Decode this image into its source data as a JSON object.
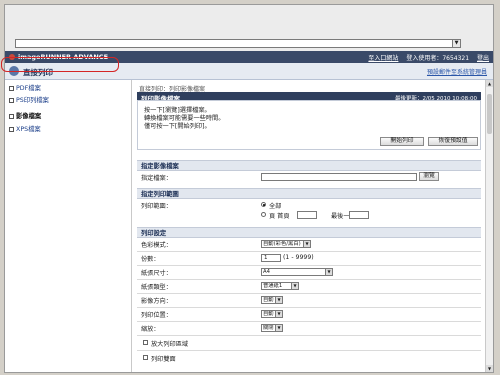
{
  "browser": {
    "address": ""
  },
  "header": {
    "brand": "imageRUNNER ADVANCE",
    "portal_link": "至入口網站",
    "login_label": "登入使用者：7654321",
    "logout_label": "登出"
  },
  "titlebar": {
    "title": "直接列印",
    "settings_link": "預設郵件至系統管理員"
  },
  "sidebar": {
    "items": [
      {
        "label": "PDF檔案"
      },
      {
        "label": "PS印列檔案"
      },
      {
        "label": "影像檔案"
      },
      {
        "label": "XPS檔案"
      }
    ]
  },
  "main": {
    "breadcrumb": "直接列印：列印影像檔案",
    "image_section": {
      "title": "列印影像檔案",
      "last_updated": "最後更新：2/05 2010 10:08:00",
      "lines": [
        "按一下[瀏覽]選擇檔案。",
        "轉換檔案可能需要一些時間。",
        "僅可按一下[開始列印]。"
      ],
      "start_print": "開始列印",
      "restore_defaults": "恢復預設值"
    },
    "specify_file": {
      "title": "指定影像檔案",
      "label": "指定檔案：",
      "file_value": "",
      "browse": "瀏覽"
    },
    "print_range": {
      "title": "指定列印範圍",
      "label": "列印範圍：",
      "all_label": "全部",
      "pages_label": "頁 首頁",
      "last_label": "最後一頁",
      "from_value": "",
      "to_value": ""
    },
    "print_settings": {
      "title": "列印設定",
      "color_mode_label": "色彩模式：",
      "color_mode_value": "自動(彩色/黑白)",
      "copies_label": "份數：",
      "copies_value": "1",
      "copies_range": "(1 - 9999)",
      "paper_size_label": "紙張尺寸：",
      "paper_size_value": "A4",
      "paper_type_label": "紙張類型：",
      "paper_type_value": "普通紙1",
      "orientation_label": "影像方向：",
      "orientation_value": "自動",
      "position_label": "列印位置：",
      "position_value": "自動",
      "zoom_label": "縮放：",
      "zoom_value": "關閉",
      "enlarge_label": "放大列印區域",
      "duplex_label": "列印雙面"
    }
  }
}
